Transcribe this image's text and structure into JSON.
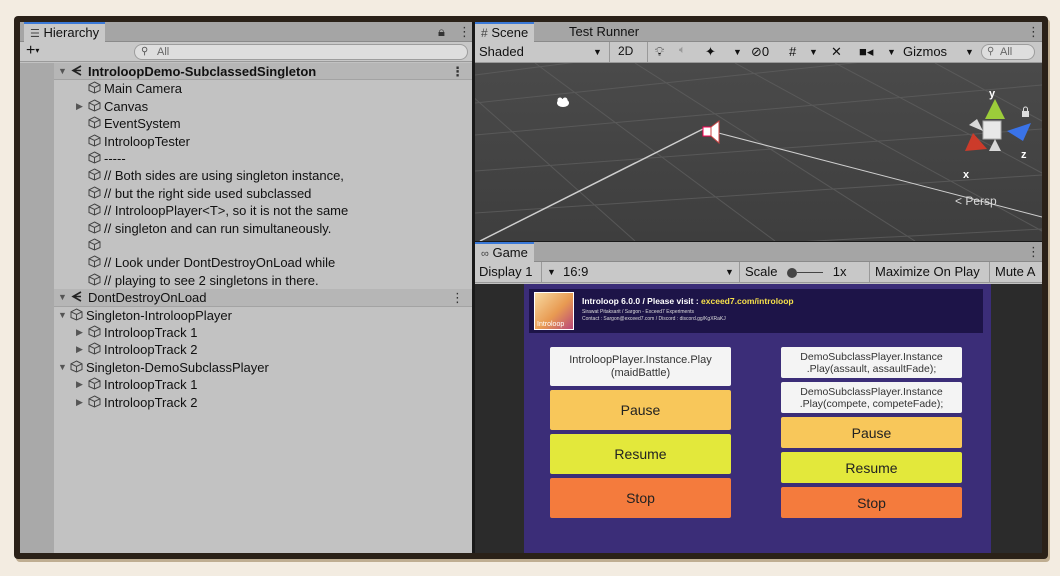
{
  "hierarchy": {
    "tab_label": "Hierarchy",
    "search_placeholder": "All",
    "rows": [
      {
        "label": "IntroloopDemo-SubclassedSingleton"
      },
      {
        "label": "Main Camera"
      },
      {
        "label": "Canvas"
      },
      {
        "label": "EventSystem"
      },
      {
        "label": "IntroloopTester"
      },
      {
        "label": "-----"
      },
      {
        "label": "// Both sides are using singleton instance,"
      },
      {
        "label": "// but the right side used subclassed"
      },
      {
        "label": "// IntroloopPlayer<T>, so it is not the same"
      },
      {
        "label": "// singleton and can run simultaneously."
      },
      {
        "label": ""
      },
      {
        "label": "// Look under DontDestroyOnLoad while"
      },
      {
        "label": "// playing to see 2 singletons in there."
      },
      {
        "label": "DontDestroyOnLoad"
      },
      {
        "label": "Singleton-IntroloopPlayer"
      },
      {
        "label": "IntroloopTrack 1"
      },
      {
        "label": "IntroloopTrack 2"
      },
      {
        "label": "Singleton-DemoSubclassPlayer"
      },
      {
        "label": "IntroloopTrack 1"
      },
      {
        "label": "IntroloopTrack 2"
      }
    ]
  },
  "scene": {
    "tabs": [
      "Scene",
      "Test Runner"
    ],
    "draw_mode": "Shaded",
    "mode_2d": "2D",
    "hidden_count": "0",
    "gizmos_label": "Gizmos",
    "search_placeholder": "All",
    "persp_label": "Persp",
    "axis_labels": {
      "x": "x",
      "y": "y",
      "z": "z"
    }
  },
  "game": {
    "tab_label": "Game",
    "display": "Display 1",
    "aspect": "16:9",
    "scale_label": "Scale",
    "scale_value": "1x",
    "maximize_label": "Maximize On Play",
    "mute_label": "Mute A",
    "banner": {
      "logo_text": "Introloop",
      "title_prefix": "Introloop 6.0.0 / Please visit : ",
      "title_link": "exceed7.com/introloop",
      "line1": "Sirawat Pitaksarit / Sargon - Exceed7 Experiments",
      "line2": "Contact : Sargon@exceed7.com / Discord : discord.gg/KgXRaKJ"
    },
    "left_buttons": {
      "play": "IntroloopPlayer.Instance.Play\n(maidBattle)",
      "pause": "Pause",
      "resume": "Resume",
      "stop": "Stop"
    },
    "right_buttons": {
      "play1": "DemoSubclassPlayer.Instance\n.Play(assault, assaultFade);",
      "play2": "DemoSubclassPlayer.Instance\n.Play(compete, competeFade);",
      "pause": "Pause",
      "resume": "Resume",
      "stop": "Stop"
    }
  }
}
